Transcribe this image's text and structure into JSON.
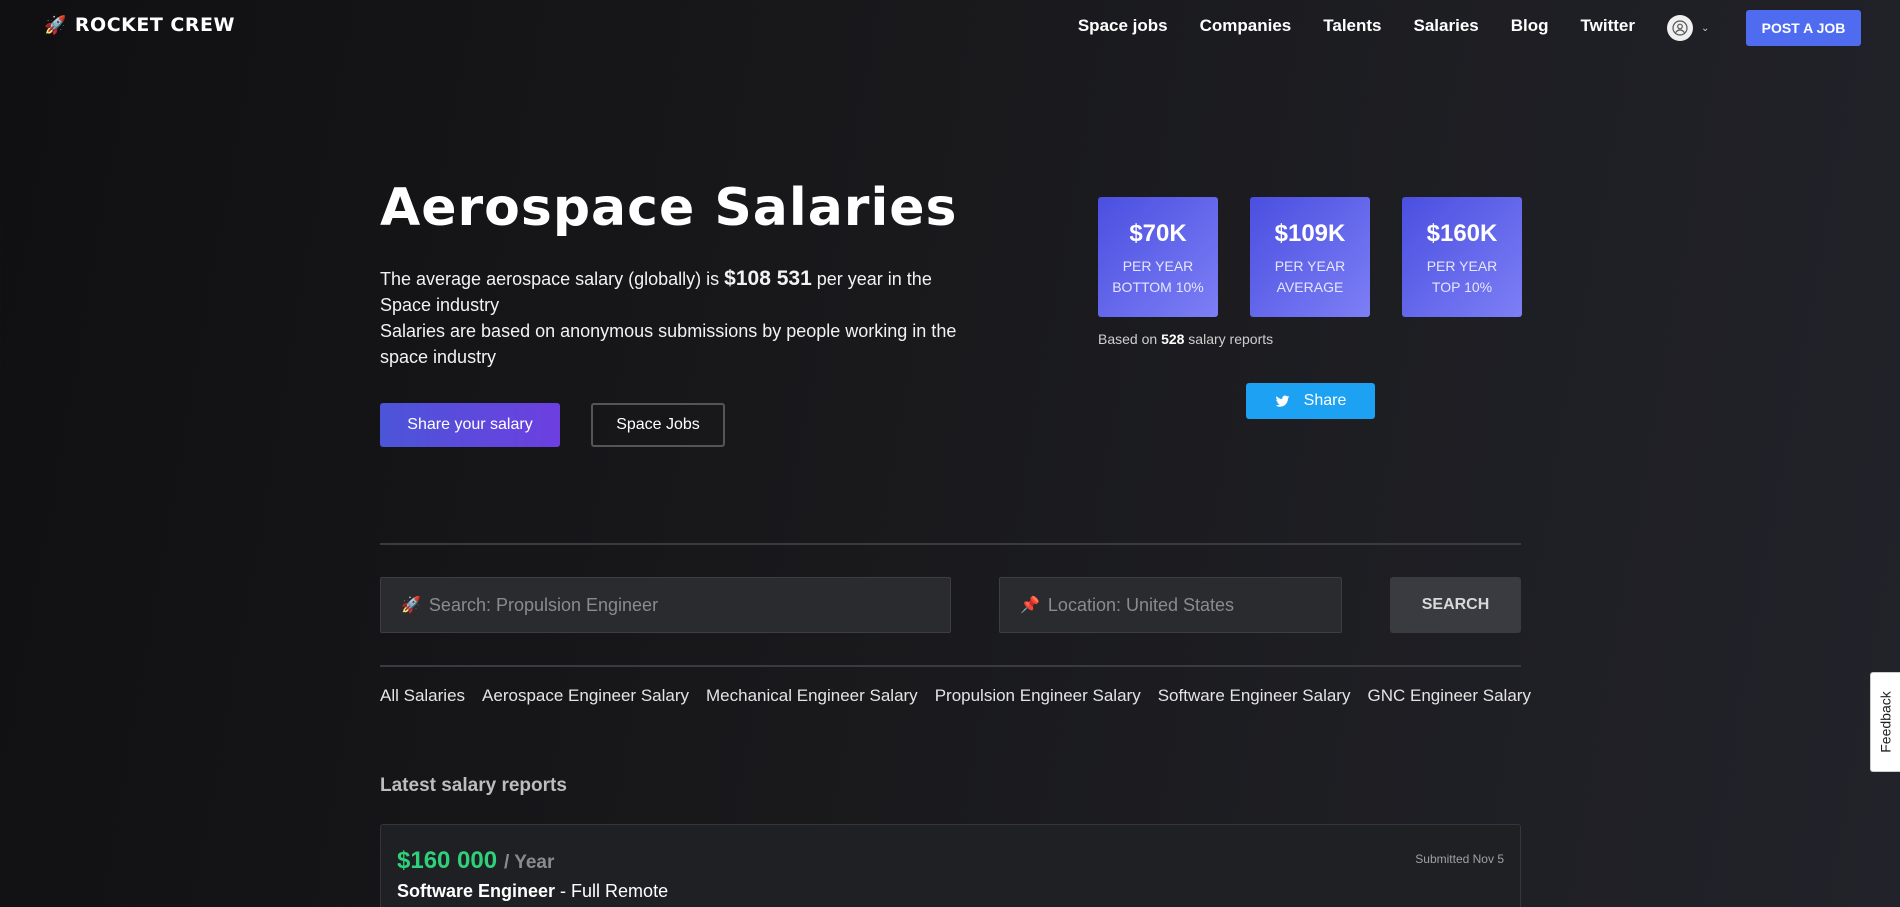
{
  "brand": {
    "name": "ROCKET CREW",
    "icon": "rocket-icon"
  },
  "nav": {
    "links": [
      "Space jobs",
      "Companies",
      "Talents",
      "Salaries",
      "Blog",
      "Twitter"
    ],
    "post_job": "POST A JOB"
  },
  "hero": {
    "title": "Aerospace Salaries",
    "line1_pre": "The average aerospace salary (globally) is ",
    "line1_amount": "$108 531",
    "line1_post": " per year in the Space industry",
    "line2": "Salaries are based on anonymous submissions by people working in the space industry",
    "share_salary": "Share your salary",
    "space_jobs": "Space Jobs"
  },
  "stats": [
    {
      "amount": "$70K",
      "line1": "PER YEAR",
      "line2": "BOTTOM 10%"
    },
    {
      "amount": "$109K",
      "line1": "PER YEAR",
      "line2": "AVERAGE"
    },
    {
      "amount": "$160K",
      "line1": "PER YEAR",
      "line2": "TOP 10%"
    }
  ],
  "based_on": {
    "pre": "Based on ",
    "count": "528",
    "post": " salary reports"
  },
  "twitter_share": "Share",
  "search": {
    "query_placeholder": "Search: Propulsion Engineer",
    "location_placeholder": "Location: United States",
    "button": "SEARCH"
  },
  "filters": [
    "All Salaries",
    "Aerospace Engineer Salary",
    "Mechanical Engineer Salary",
    "Propulsion Engineer Salary",
    "Software Engineer Salary",
    "GNC Engineer Salary"
  ],
  "latest_heading": "Latest salary reports",
  "report": {
    "amount": "$160 000",
    "per": "/ Year",
    "role": "Software Engineer",
    "mode": " - Full Remote",
    "submitted": "Submitted Nov 5"
  },
  "feedback": "Feedback",
  "colors": {
    "accent": "#4f6cf0",
    "salary_green": "#2fd07a",
    "twitter": "#1da1f2"
  }
}
